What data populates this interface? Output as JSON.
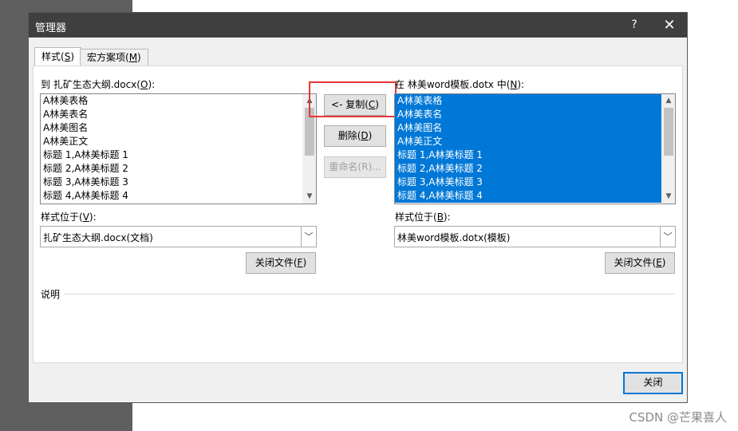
{
  "dialog": {
    "title": "管理器",
    "help": "?",
    "close": "✕"
  },
  "tabs": [
    {
      "label": "样式(",
      "key": "S",
      "suffix": ")"
    },
    {
      "label": "宏方案项(",
      "key": "M",
      "suffix": ")"
    }
  ],
  "left": {
    "label": "到 扎矿生态大纲.docx(",
    "label_key": "O",
    "label_suffix": "):",
    "items": [
      "A林美表格",
      "A林美表名",
      "A林美图名",
      "A林美正文",
      "标题 1,A林美标题 1",
      "标题 2,A林美标题 2",
      "标题 3,A林美标题 3",
      "标题 4,A林美标题 4"
    ],
    "location_label": "样式位于(",
    "location_key": "V",
    "location_suffix": "):",
    "location_value": "扎矿生态大纲.docx(文档)",
    "close_file_label": "关闭文件(",
    "close_file_key": "F",
    "close_file_suffix": ")"
  },
  "right": {
    "label": "在 林美word模板.dotx 中(",
    "label_key": "N",
    "label_suffix": "):",
    "items": [
      "A林美表格",
      "A林美表名",
      "A林美图名",
      "A林美正文",
      "标题 1,A林美标题 1",
      "标题 2,A林美标题 2",
      "标题 3,A林美标题 3",
      "标题 4,A林美标题 4"
    ],
    "location_label": "样式位于(",
    "location_key": "B",
    "location_suffix": "):",
    "location_value": "林美word模板.dotx(模板)",
    "close_file_label": "关闭文件(",
    "close_file_key": "E",
    "close_file_suffix": ")"
  },
  "middle": {
    "copy_label": "<- 复制(",
    "copy_key": "C",
    "copy_suffix": ")",
    "delete_label": "删除(",
    "delete_key": "D",
    "delete_suffix": ")",
    "rename_label": "重命名(R)..."
  },
  "description_label": "说明",
  "footer": {
    "close_label": "关闭"
  },
  "watermark": "CSDN @芒果喜人",
  "colors": {
    "titlebar": "#3f3f3f",
    "selection": "#0078d7",
    "highlight": "#e53935"
  }
}
